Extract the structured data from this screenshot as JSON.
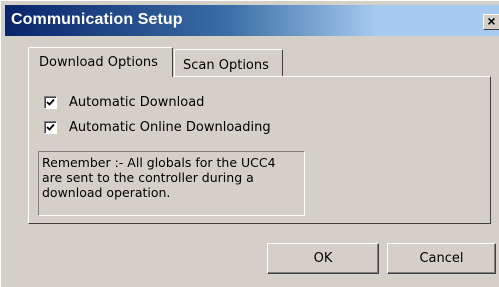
{
  "window": {
    "title": "Communication Setup",
    "close_glyph": "×"
  },
  "tabs": [
    {
      "label": "Download Options",
      "selected": true
    },
    {
      "label": "Scan Options",
      "selected": false
    }
  ],
  "options": [
    {
      "label": "Automatic Download",
      "checked": true
    },
    {
      "label": "Automatic Online Downloading",
      "checked": true
    }
  ],
  "note": {
    "lines": [
      "Remember :- All globals for the UCC4",
      "are sent to the controller during a",
      "download operation."
    ]
  },
  "buttons": {
    "ok_label": "OK",
    "cancel_label": "Cancel"
  }
}
